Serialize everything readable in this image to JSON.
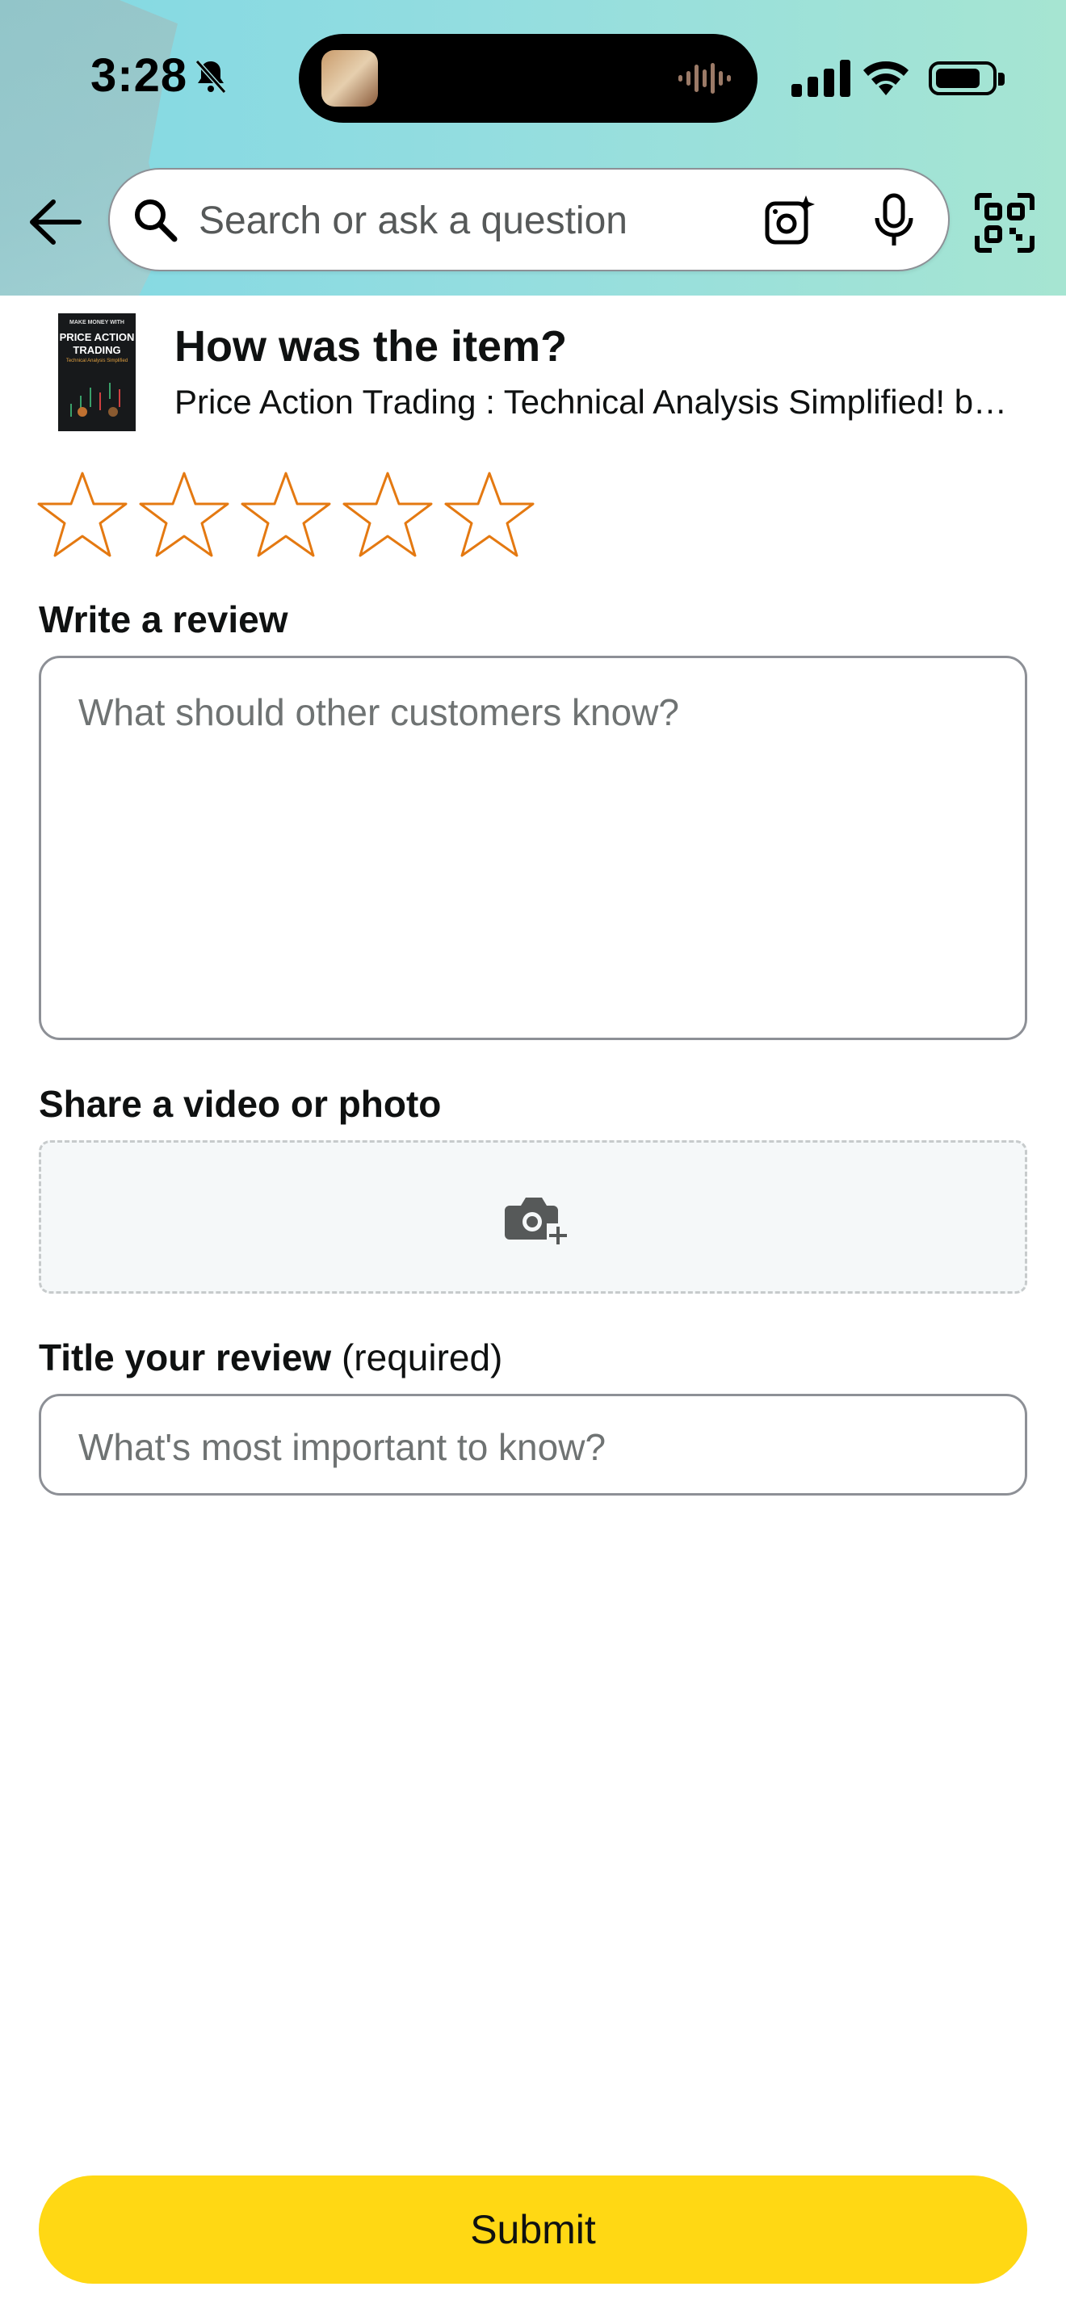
{
  "status_bar": {
    "time": "3:28"
  },
  "search": {
    "placeholder": "Search or ask a question"
  },
  "product": {
    "cover_text": {
      "top": "MAKE MONEY WITH",
      "title_line1": "PRICE ACTION",
      "title_line2": "TRADING",
      "subtitle": "Technical Analysis Simplified"
    },
    "question": "How was the item?",
    "name": "Price Action Trading : Technical Analysis Simplified! b…"
  },
  "rating": {
    "stars": 5,
    "selected": 0,
    "star_color": "#e47911"
  },
  "review": {
    "label": "Write a review",
    "placeholder": "What should other customers know?"
  },
  "media": {
    "label": "Share a video or photo"
  },
  "title_field": {
    "label": "Title your review",
    "required_text": "(required)",
    "placeholder": "What's most important to know?"
  },
  "submit": {
    "label": "Submit",
    "color": "#ffd814"
  }
}
